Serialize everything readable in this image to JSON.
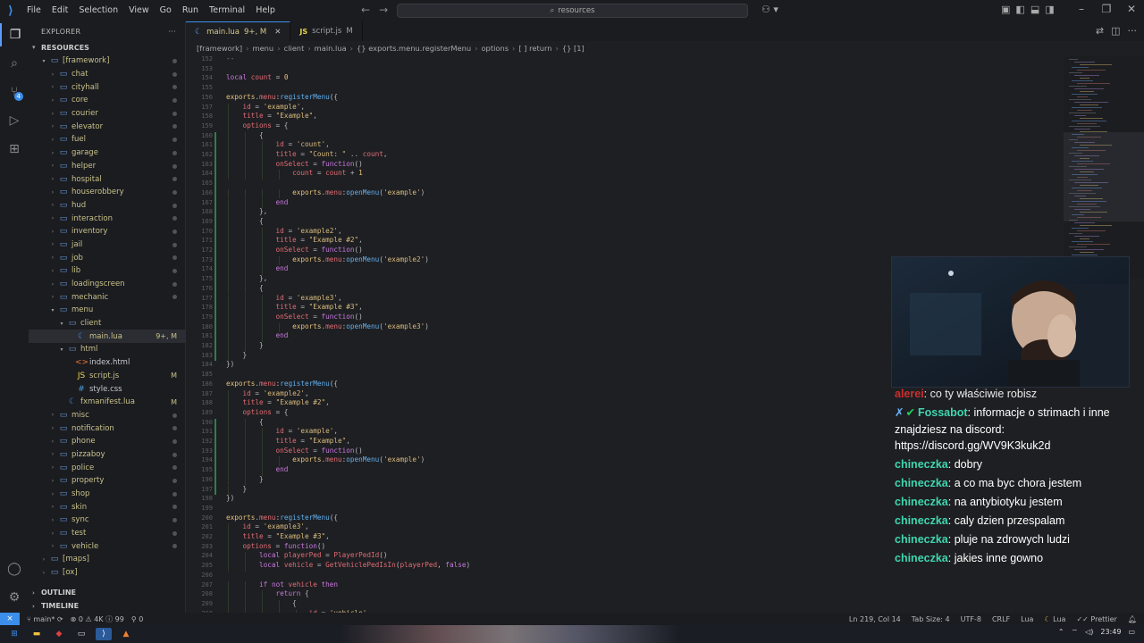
{
  "menu": [
    "File",
    "Edit",
    "Selection",
    "View",
    "Go",
    "Run",
    "Terminal",
    "Help"
  ],
  "search_text": "resources",
  "explorer": {
    "title": "EXPLORER",
    "root": "RESOURCES",
    "items": [
      {
        "label": "[framework]",
        "depth": 0,
        "type": "folder-open"
      },
      {
        "label": "chat",
        "depth": 1,
        "type": "folder"
      },
      {
        "label": "cityhall",
        "depth": 1,
        "type": "folder"
      },
      {
        "label": "core",
        "depth": 1,
        "type": "folder"
      },
      {
        "label": "courier",
        "depth": 1,
        "type": "folder"
      },
      {
        "label": "elevator",
        "depth": 1,
        "type": "folder"
      },
      {
        "label": "fuel",
        "depth": 1,
        "type": "folder"
      },
      {
        "label": "garage",
        "depth": 1,
        "type": "folder"
      },
      {
        "label": "helper",
        "depth": 1,
        "type": "folder"
      },
      {
        "label": "hospital",
        "depth": 1,
        "type": "folder"
      },
      {
        "label": "houserobbery",
        "depth": 1,
        "type": "folder"
      },
      {
        "label": "hud",
        "depth": 1,
        "type": "folder"
      },
      {
        "label": "interaction",
        "depth": 1,
        "type": "folder"
      },
      {
        "label": "inventory",
        "depth": 1,
        "type": "folder"
      },
      {
        "label": "jail",
        "depth": 1,
        "type": "folder"
      },
      {
        "label": "job",
        "depth": 1,
        "type": "folder"
      },
      {
        "label": "lib",
        "depth": 1,
        "type": "folder"
      },
      {
        "label": "loadingscreen",
        "depth": 1,
        "type": "folder"
      },
      {
        "label": "mechanic",
        "depth": 1,
        "type": "folder"
      },
      {
        "label": "menu",
        "depth": 1,
        "type": "folder-open"
      },
      {
        "label": "client",
        "depth": 2,
        "type": "folder-open"
      },
      {
        "label": "main.lua",
        "depth": 3,
        "type": "lua",
        "mark": "9+, M",
        "selected": true
      },
      {
        "label": "html",
        "depth": 2,
        "type": "folder-open"
      },
      {
        "label": "index.html",
        "depth": 3,
        "type": "html"
      },
      {
        "label": "script.js",
        "depth": 3,
        "type": "js",
        "mark": "M"
      },
      {
        "label": "style.css",
        "depth": 3,
        "type": "css"
      },
      {
        "label": "fxmanifest.lua",
        "depth": 2,
        "type": "lua",
        "mark": "M"
      },
      {
        "label": "misc",
        "depth": 1,
        "type": "folder"
      },
      {
        "label": "notification",
        "depth": 1,
        "type": "folder"
      },
      {
        "label": "phone",
        "depth": 1,
        "type": "folder"
      },
      {
        "label": "pizzaboy",
        "depth": 1,
        "type": "folder"
      },
      {
        "label": "police",
        "depth": 1,
        "type": "folder"
      },
      {
        "label": "property",
        "depth": 1,
        "type": "folder"
      },
      {
        "label": "shop",
        "depth": 1,
        "type": "folder"
      },
      {
        "label": "skin",
        "depth": 1,
        "type": "folder"
      },
      {
        "label": "sync",
        "depth": 1,
        "type": "folder"
      },
      {
        "label": "test",
        "depth": 1,
        "type": "folder"
      },
      {
        "label": "vehicle",
        "depth": 1,
        "type": "folder"
      },
      {
        "label": "[maps]",
        "depth": 0,
        "type": "folder"
      },
      {
        "label": "[ox]",
        "depth": 0,
        "type": "folder"
      }
    ],
    "outline": "OUTLINE",
    "timeline": "TIMELINE"
  },
  "tabs": [
    {
      "label": "main.lua",
      "status": "9+, M",
      "active": true
    },
    {
      "label": "script.js",
      "status": "M",
      "active": false
    }
  ],
  "breadcrumb": [
    "[framework]",
    "menu",
    "client",
    "main.lua",
    "{} exports.menu.registerMenu",
    "options",
    "[ ] return",
    "{} [1]"
  ],
  "code_lines": [
    {
      "n": "152",
      "t": "--"
    },
    {
      "n": "153",
      "t": ""
    },
    {
      "n": "154",
      "t": "local count = 0"
    },
    {
      "n": "155",
      "t": ""
    },
    {
      "n": "156",
      "t": "exports.menu:registerMenu({"
    },
    {
      "n": "157",
      "t": "    id = 'example',"
    },
    {
      "n": "158",
      "t": "    title = \"Example\","
    },
    {
      "n": "159",
      "t": "    options = {"
    },
    {
      "n": "160",
      "t": "        {"
    },
    {
      "n": "161",
      "t": "            id = 'count',"
    },
    {
      "n": "162",
      "t": "            title = \"Count: \" .. count,"
    },
    {
      "n": "163",
      "t": "            onSelect = function()"
    },
    {
      "n": "164",
      "t": "                count = count + 1"
    },
    {
      "n": "165",
      "t": ""
    },
    {
      "n": "166",
      "t": "                exports.menu:openMenu('example')"
    },
    {
      "n": "167",
      "t": "            end"
    },
    {
      "n": "168",
      "t": "        },"
    },
    {
      "n": "169",
      "t": "        {"
    },
    {
      "n": "170",
      "t": "            id = 'example2',"
    },
    {
      "n": "171",
      "t": "            title = \"Example #2\","
    },
    {
      "n": "172",
      "t": "            onSelect = function()"
    },
    {
      "n": "173",
      "t": "                exports.menu:openMenu('example2')"
    },
    {
      "n": "174",
      "t": "            end"
    },
    {
      "n": "175",
      "t": "        },"
    },
    {
      "n": "176",
      "t": "        {"
    },
    {
      "n": "177",
      "t": "            id = 'example3',"
    },
    {
      "n": "178",
      "t": "            title = \"Example #3\","
    },
    {
      "n": "179",
      "t": "            onSelect = function()"
    },
    {
      "n": "180",
      "t": "                exports.menu:openMenu('example3')"
    },
    {
      "n": "181",
      "t": "            end"
    },
    {
      "n": "182",
      "t": "        }"
    },
    {
      "n": "183",
      "t": "    }"
    },
    {
      "n": "184",
      "t": "})"
    },
    {
      "n": "185",
      "t": ""
    },
    {
      "n": "186",
      "t": "exports.menu:registerMenu({"
    },
    {
      "n": "187",
      "t": "    id = 'example2',"
    },
    {
      "n": "188",
      "t": "    title = \"Example #2\","
    },
    {
      "n": "189",
      "t": "    options = {"
    },
    {
      "n": "190",
      "t": "        {"
    },
    {
      "n": "191",
      "t": "            id = 'example',"
    },
    {
      "n": "192",
      "t": "            title = \"Example\","
    },
    {
      "n": "193",
      "t": "            onSelect = function()"
    },
    {
      "n": "194",
      "t": "                exports.menu:openMenu('example')"
    },
    {
      "n": "195",
      "t": "            end"
    },
    {
      "n": "196",
      "t": "        }"
    },
    {
      "n": "197",
      "t": "    }"
    },
    {
      "n": "198",
      "t": "})"
    },
    {
      "n": "199",
      "t": ""
    },
    {
      "n": "200",
      "t": "exports.menu:registerMenu({"
    },
    {
      "n": "201",
      "t": "    id = 'example3',"
    },
    {
      "n": "202",
      "t": "    title = \"Example #3\","
    },
    {
      "n": "203",
      "t": "    options = function()"
    },
    {
      "n": "204",
      "t": "        local playerPed = PlayerPedId()"
    },
    {
      "n": "205",
      "t": "        local vehicle = GetVehiclePedIsIn(playerPed, false)"
    },
    {
      "n": "206",
      "t": ""
    },
    {
      "n": "207",
      "t": "        if not vehicle then"
    },
    {
      "n": "208",
      "t": "            return {"
    },
    {
      "n": "209",
      "t": "                {"
    },
    {
      "n": "210",
      "t": "                    id = 'vehicle',"
    }
  ],
  "chat": [
    {
      "user": "alerei",
      "text": "co ty właściwie robisz",
      "partial": true
    },
    {
      "user": "Fossabot",
      "text": "informacje o strimach i inne znajdziesz na discord: https://discord.gg/WV9K3kuk2d",
      "bot": true
    },
    {
      "user": "chineczka",
      "text": "dobry"
    },
    {
      "user": "chineczka",
      "text": "a co ma byc chora jestem"
    },
    {
      "user": "chineczka",
      "text": "na antybiotyku jestem"
    },
    {
      "user": "chineczka",
      "text": "caly dzien przespalam"
    },
    {
      "user": "chineczka",
      "text": "pluje na zdrowych ludzi"
    },
    {
      "user": "chineczka",
      "text": "jakies inne gowno"
    }
  ],
  "status": {
    "branch": "main*",
    "problems_errors": "0",
    "problems_warnings": "4K",
    "problems_info": "99",
    "ports": "0",
    "position": "Ln 219, Col 14",
    "tab_size": "Tab Size: 4",
    "encoding": "UTF-8",
    "eol": "CRLF",
    "language": "Lua",
    "lua_label": "Lua",
    "prettier": "Prettier"
  },
  "taskbar": {
    "time": "23:49"
  },
  "colors": {
    "accent": "#3b8eea",
    "chat_user": "#3fd6b0",
    "modified": "#c8c18a"
  }
}
